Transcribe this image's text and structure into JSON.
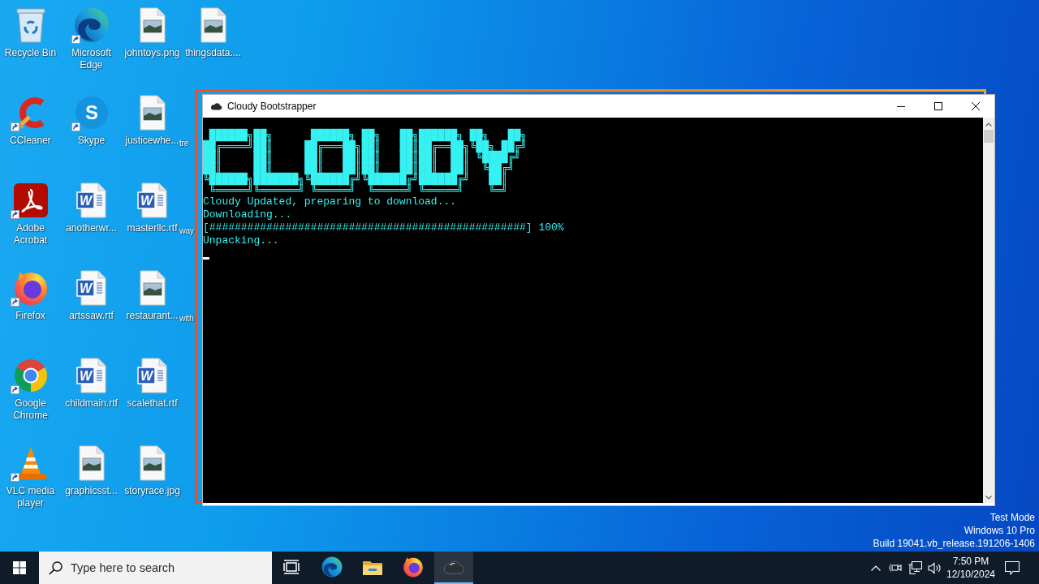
{
  "desktop": {
    "icons": [
      {
        "label": "Recycle Bin",
        "kind": "recycle_bin",
        "shortcut": false,
        "covered": false
      },
      {
        "label": "CCleaner",
        "kind": "ccleaner",
        "shortcut": true,
        "covered": false
      },
      {
        "label": "Adobe Acrobat",
        "kind": "acrobat",
        "shortcut": true,
        "covered": false
      },
      {
        "label": "Firefox",
        "kind": "firefox",
        "shortcut": true,
        "covered": false
      },
      {
        "label": "Google Chrome",
        "kind": "chrome",
        "shortcut": true,
        "covered": false
      },
      {
        "label": "VLC media player",
        "kind": "vlc",
        "shortcut": true,
        "covered": false
      },
      {
        "label": "Microsoft Edge",
        "kind": "edge",
        "shortcut": true,
        "covered": false
      },
      {
        "label": "Skype",
        "kind": "skype",
        "letter": "S",
        "shortcut": true,
        "covered": false
      },
      {
        "label": "anotherwr...",
        "kind": "word",
        "letter": "W",
        "shortcut": false,
        "covered": false
      },
      {
        "label": "artssaw.rtf",
        "kind": "word",
        "letter": "W",
        "shortcut": false,
        "covered": false
      },
      {
        "label": "childmain.rtf",
        "kind": "word",
        "letter": "W",
        "shortcut": false,
        "covered": false
      },
      {
        "label": "graphicsst...",
        "kind": "image",
        "shortcut": false,
        "covered": false
      },
      {
        "label": "johntoys.png",
        "kind": "image",
        "shortcut": false,
        "covered": false
      },
      {
        "label": "justicewhe...",
        "kind": "image",
        "shortcut": false,
        "covered": false
      },
      {
        "label": "masterllc.rtf",
        "kind": "word",
        "letter": "W",
        "shortcut": false,
        "covered": false
      },
      {
        "label": "restaurant...",
        "kind": "image",
        "shortcut": false,
        "covered": false
      },
      {
        "label": "scalethat.rtf",
        "kind": "word",
        "letter": "W",
        "shortcut": false,
        "covered": false
      },
      {
        "label": "storyrace.jpg",
        "kind": "image",
        "shortcut": false,
        "covered": false
      },
      {
        "label": "thingsdata....",
        "kind": "image",
        "shortcut": false,
        "covered": false
      },
      {
        "label": "tre",
        "covered": true
      },
      {
        "label": "way",
        "covered": true
      },
      {
        "label": "with",
        "covered": true
      }
    ],
    "notice": [
      "Test Mode",
      "Windows 10 Pro",
      "Build 19041.vb_release.191206-1406"
    ]
  },
  "window": {
    "title": "Cloudy Bootstrapper",
    "highlighted": true,
    "console": {
      "banner": [
        " ██████╗██╗      ██████╗ ██╗   ██╗██████╗ ██╗   ██╗",
        "██╔════╝██║     ██╔═══██╗██║   ██║██╔══██╗╚██╗ ██╔╝",
        "██║     ██║     ██║   ██║██║   ██║██║  ██║ ╚████╔╝",
        "██║     ██║     ██║   ██║██║   ██║██║  ██║  ╚██╔╝",
        "╚██████╗███████╗╚██████╔╝╚██████╔╝██████╔╝   ██║",
        " ╚═════╝╚══════╝ ╚═════╝  ╚═════╝ ╚═════╝    ╚═╝"
      ],
      "lines": [
        "Cloudy Updated, preparing to download...",
        "Downloading...",
        "[##################################################] 100%",
        "Unpacking..."
      ],
      "cursor": true
    }
  },
  "taskbar": {
    "search": {
      "placeholder": "Type here to search"
    },
    "apps": [
      {
        "kind": "task_view",
        "active": false
      },
      {
        "kind": "edge",
        "active": false
      },
      {
        "kind": "explorer",
        "active": false
      },
      {
        "kind": "firefox",
        "active": false
      },
      {
        "kind": "cloud",
        "active": true
      }
    ],
    "tray": {
      "time": "7:50 PM",
      "date": "12/10/2024"
    }
  }
}
